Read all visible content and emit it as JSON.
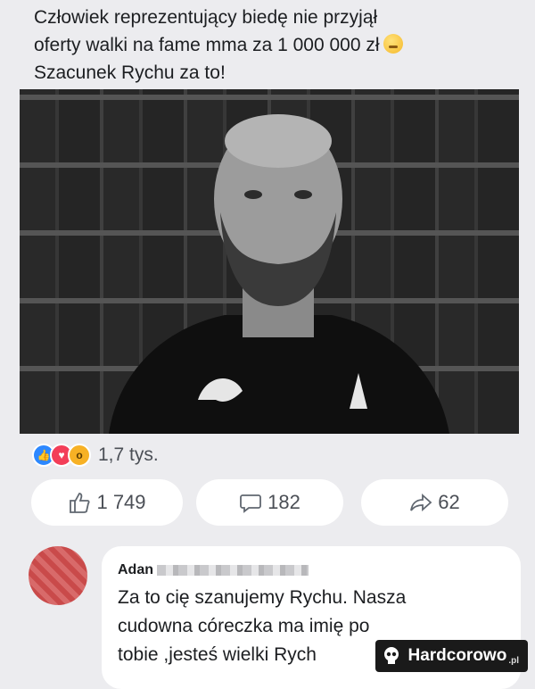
{
  "post": {
    "lines": [
      "Człowiek reprezentujący biedę nie przyjął",
      "oferty walki na fame mma za 1 000 000 zł",
      "Szacunek Rychu za to!"
    ]
  },
  "reactions": {
    "count": "1,7 tys."
  },
  "actions": {
    "likes": "1 749",
    "comments": "182",
    "shares": "62"
  },
  "comment": {
    "author": "Adan",
    "lines": [
      "Za to cię szanujemy Rychu. Nasza",
      "cudowna córeczka ma imię po",
      "tobie ,jesteś wielki Rych"
    ]
  },
  "watermark": {
    "brand": "Hardcorowo",
    "suffix": ".pl"
  }
}
